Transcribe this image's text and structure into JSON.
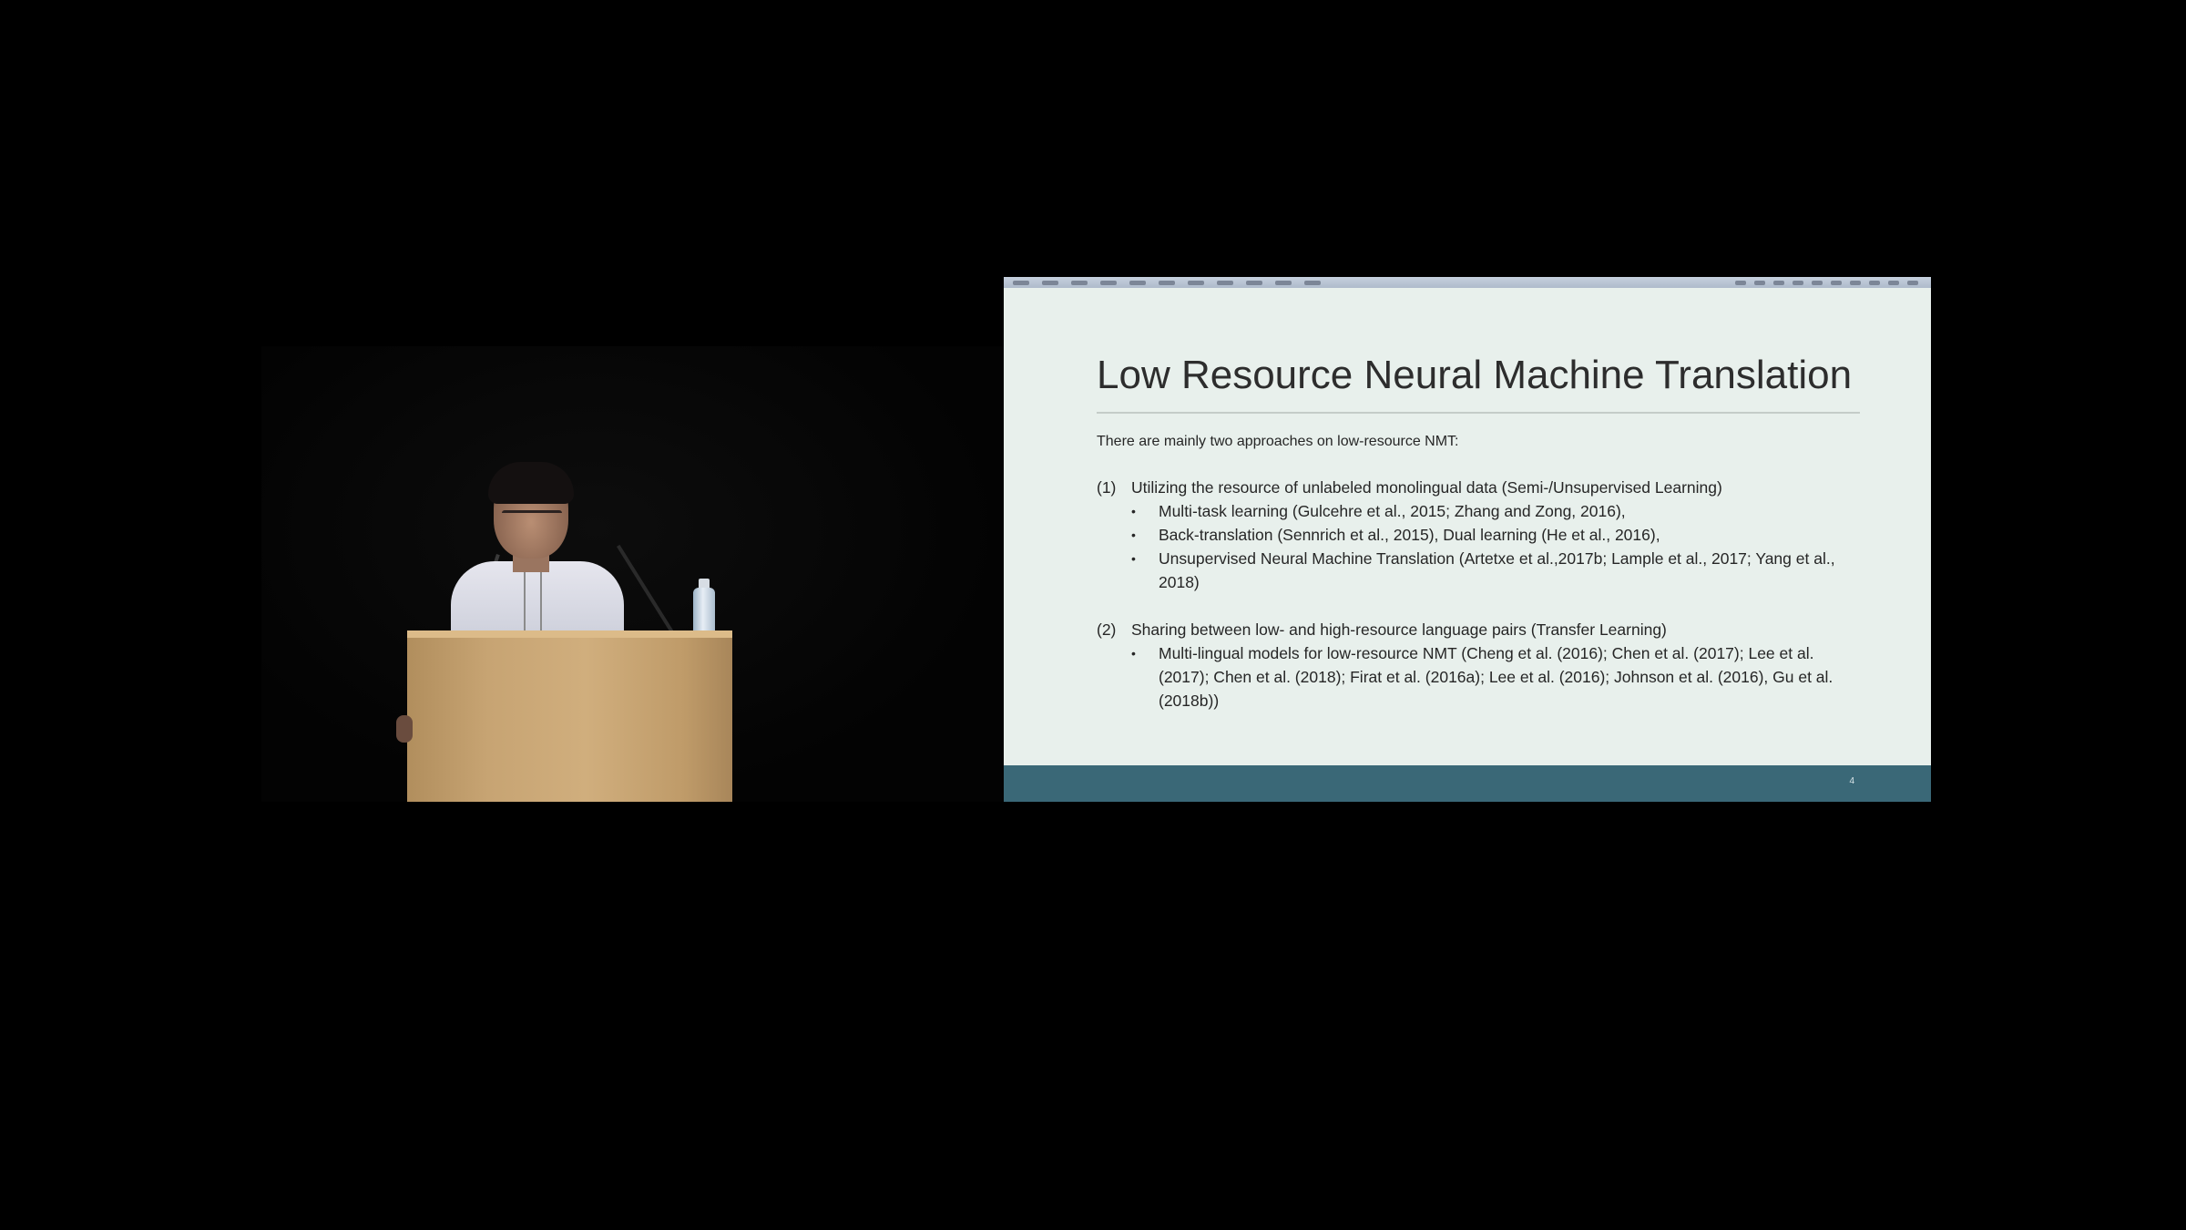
{
  "slide": {
    "title": "Low Resource Neural Machine Translation",
    "intro": "There are mainly two approaches on low-resource NMT:",
    "sections": [
      {
        "number": "(1)",
        "heading": "Utilizing the resource of unlabeled monolingual data (Semi-/Unsupervised Learning)",
        "bullets": [
          "Multi-task learning (Gulcehre et al., 2015; Zhang and Zong, 2016),",
          "Back-translation (Sennrich et al., 2015), Dual learning (He et al., 2016),",
          "Unsupervised Neural Machine Translation (Artetxe et al.,2017b; Lample et al., 2017; Yang et al., 2018)"
        ]
      },
      {
        "number": "(2)",
        "heading": "Sharing between low- and high-resource language pairs (Transfer Learning)",
        "bullets": [
          "Multi-lingual models for low-resource NMT (Cheng et al. (2016); Chen et al. (2017); Lee et al. (2017); Chen et al. (2018); Firat et al. (2016a); Lee et al. (2016); Johnson et al. (2016), Gu et al. (2018b))"
        ]
      }
    ],
    "bullet_glyph": "•",
    "page_number": "4",
    "colors": {
      "background": "#e8f0ec",
      "footer": "#3a6877",
      "text": "#262626"
    }
  }
}
